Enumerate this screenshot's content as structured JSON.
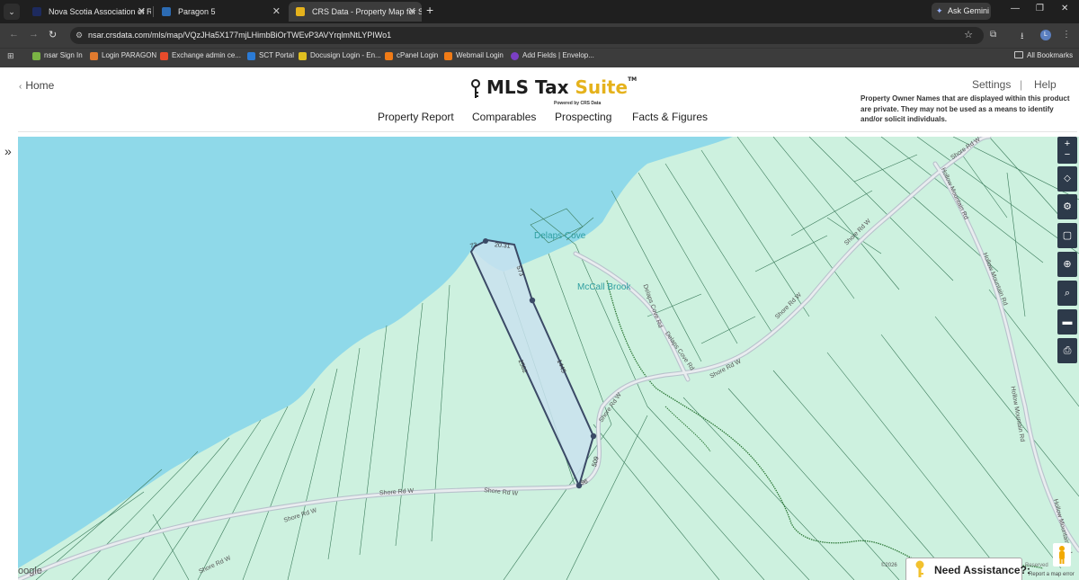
{
  "browser": {
    "tabs": [
      {
        "title": "Nova Scotia Association of Rea",
        "active": false
      },
      {
        "title": "Paragon 5",
        "active": false
      },
      {
        "title": "CRS Data - Property Map for Sh",
        "active": true
      }
    ],
    "ask_gemini": "Ask Gemini",
    "url": "nsar.crsdata.com/mls/map/VQzJHa5X177mjLHimbBiOrTWEvP3AVYrqlmNtLYPIWo1",
    "bookmarks": [
      "nsar Sign In",
      "Login PARAGON",
      "Exchange admin ce...",
      "SCT Portal",
      "Docusign Login - En...",
      "cPanel Login",
      "Webmail Login",
      "Add Fields | Envelop..."
    ],
    "all_bookmarks": "All Bookmarks",
    "profile_initial": "L"
  },
  "site": {
    "home": "Home",
    "logo_mls": "MLS Tax ",
    "logo_suite": "Suite",
    "logo_tm": "TM",
    "logo_powered": "Powered by CRS Data",
    "settings": "Settings",
    "separator": "|",
    "help": "Help",
    "privacy_notice": "Property Owner Names that are displayed within this product are private. They may not be used as a means to identify and/or solicit individuals.",
    "nav": [
      "Property Report",
      "Comparables",
      "Prospecting",
      "Facts & Figures"
    ],
    "sidebar_toggle": "»"
  },
  "map": {
    "place_labels": [
      "Delaps Cove",
      "McCall Brook"
    ],
    "road_labels": [
      "Shore Rd W",
      "Hollow Mountain Rd",
      "Delaps Cove Rd"
    ],
    "dimension_labels": [
      "20.31",
      "573",
      "1445",
      "2562",
      "509",
      "96",
      "73"
    ],
    "attribution": "©2026",
    "reserved": "Reserved",
    "report_error": "Report a map error",
    "google": "oogle",
    "need_assistance": "Need Assistance?:"
  },
  "colors": {
    "water": "#8fd9e9",
    "land": "#cdf1df",
    "parcel_fill": "#c9e2ef",
    "parcel_stroke": "#3b4a66",
    "accent": "#e5b21c"
  }
}
